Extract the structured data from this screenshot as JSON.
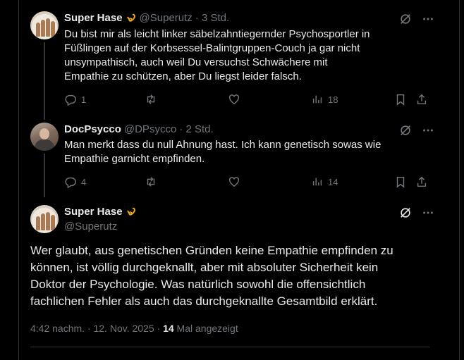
{
  "tweets": [
    {
      "name": "Super Hase",
      "handle": "@Superutz",
      "time": "· 3 Std.",
      "text": "Du bist mir als leicht linker säbelzahntiegernder Psychosportler in\nFüßlingen auf der Korbsessel-Balintgruppen-Couch ja gar nicht\nunsympathisch, auch weil Du versuchst Schwächere mit\nEmpathie zu schützen, aber Du liegst leider falsch.",
      "replies": "1",
      "reposts": "",
      "likes": "",
      "views": "18"
    },
    {
      "name": "DocPsycco",
      "handle": "@DPsycco",
      "time": "· 2 Std.",
      "text": "Man merkt dass du null Ahnung hast. Ich kann genetisch sowas wie\nEmpathie garnicht empfinden.",
      "replies": "4",
      "reposts": "",
      "likes": "",
      "views": "14"
    }
  ],
  "main": {
    "name": "Super Hase",
    "handle": "@Superutz",
    "text": "Wer glaubt, aus genetischen Gründen keine Empathie empfinden zu\nkönnen, ist völlig durchgeknallt, aber mit absoluter Sicherheit kein\nDoktor der Psychologie. Was natürlich sowohl die offensichtlich\nfachlichen Fehler als auch das durchgeknallte Gesamtbild erklärt.",
    "timestamp": "4:42 nachm. · 12. Nov. 2025 · ",
    "views_count": "14",
    "views_label": " Mal angezeigt"
  },
  "icons": {
    "badge": "verified-gold-icon",
    "grok": "grok-icon",
    "more": "more-icon",
    "reply": "reply-icon",
    "repost": "repost-icon",
    "like": "like-icon",
    "views": "views-icon",
    "bookmark": "bookmark-icon",
    "share": "share-icon"
  },
  "colors": {
    "background": "#000000",
    "text": "#e7e9ea",
    "secondary": "#71767b",
    "border": "#2f3336",
    "badge": "#e7a31a"
  }
}
